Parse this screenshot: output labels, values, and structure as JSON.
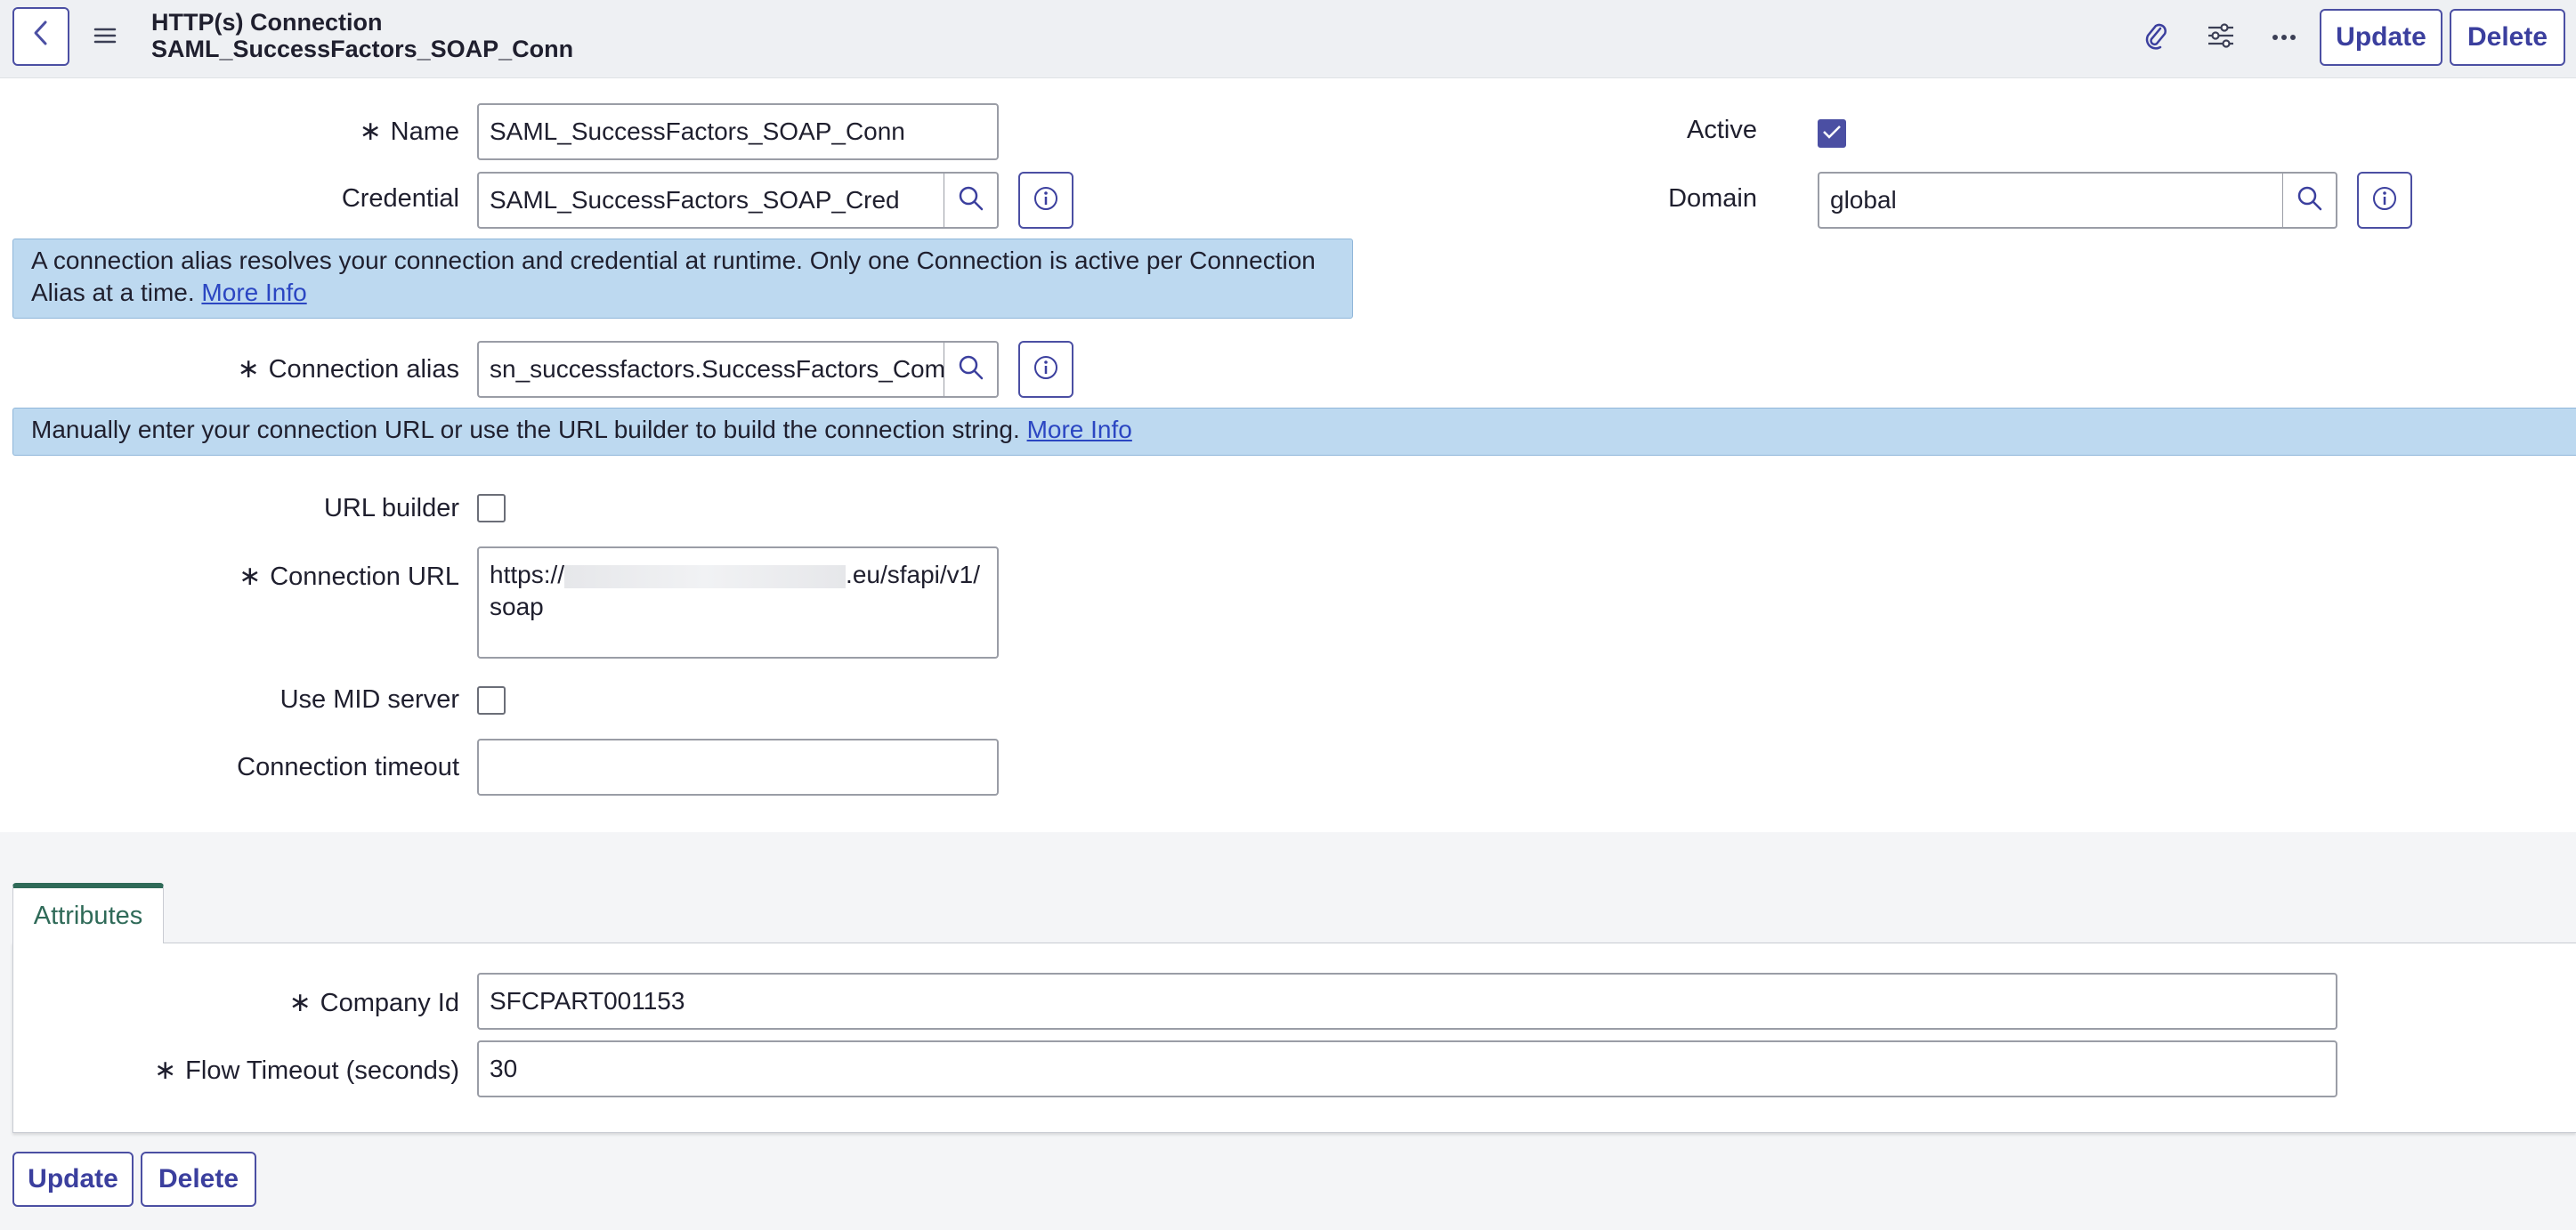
{
  "header": {
    "title": "HTTP(s) Connection",
    "subtitle": "SAML_SuccessFactors_SOAP_Conn",
    "update_label": "Update",
    "delete_label": "Delete"
  },
  "form": {
    "name_label": "Name",
    "name_value": "SAML_SuccessFactors_SOAP_Conn",
    "credential_label": "Credential",
    "credential_value": "SAML_SuccessFactors_SOAP_Cred",
    "active_label": "Active",
    "active_checked": true,
    "domain_label": "Domain",
    "domain_value": "global",
    "alias_banner_text": "A connection alias resolves your connection and credential at runtime. Only one Connection is active per Connection Alias at a time.",
    "alias_banner_link": "More Info",
    "connection_alias_label": "Connection alias",
    "connection_alias_value": "sn_successfactors.SuccessFactors_Comp",
    "url_banner_text": "Manually enter your connection URL or use the URL builder to build the connection string.",
    "url_banner_link": "More Info",
    "url_builder_label": "URL builder",
    "url_builder_checked": false,
    "connection_url_label": "Connection URL",
    "connection_url_prefix": "https://",
    "connection_url_suffix": ".eu/sfapi/v1/",
    "connection_url_line2": "soap",
    "mid_server_label": "Use MID server",
    "mid_server_checked": false,
    "timeout_label": "Connection timeout",
    "timeout_value": ""
  },
  "attributes": {
    "tab_label": "Attributes",
    "company_id_label": "Company Id",
    "company_id_value": "SFCPART001153",
    "flow_timeout_label": "Flow Timeout (seconds)",
    "flow_timeout_value": "30"
  },
  "footer": {
    "update_label": "Update",
    "delete_label": "Delete"
  },
  "icons": {
    "back": "chevron-left-icon",
    "menu": "hamburger-menu-icon",
    "attachment": "paperclip-icon",
    "settings": "sliders-icon",
    "more": "ellipsis-icon",
    "search": "search-icon",
    "info": "info-icon",
    "required": "asterisk-icon",
    "check": "checkmark-icon"
  },
  "colors": {
    "accent": "#4b4fa3",
    "banner": "#bdd9f0",
    "link": "#2b46c2",
    "tab_accent": "#2f6a58"
  }
}
